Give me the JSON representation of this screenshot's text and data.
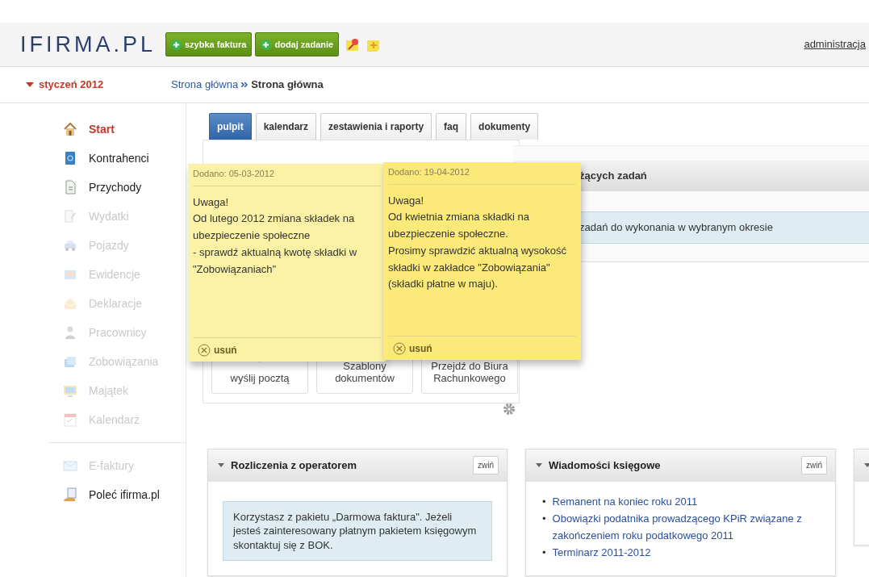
{
  "header": {
    "logo": "IFIRMA.PL",
    "buttons": [
      {
        "label": "szybka faktura"
      },
      {
        "label": "dodaj zadanie"
      }
    ],
    "user_menu": "administracja"
  },
  "period": "styczeń 2012",
  "breadcrumb": [
    "Strona główna",
    "Strona główna"
  ],
  "sidebar": {
    "items": [
      {
        "label": "Start",
        "selected": true,
        "disabled": false
      },
      {
        "label": "Kontrahenci",
        "selected": false,
        "disabled": false
      },
      {
        "label": "Przychody",
        "selected": false,
        "disabled": false
      },
      {
        "label": "Wydatki",
        "selected": false,
        "disabled": true
      },
      {
        "label": "Pojazdy",
        "selected": false,
        "disabled": true
      },
      {
        "label": "Ewidencje",
        "selected": false,
        "disabled": true
      },
      {
        "label": "Deklaracje",
        "selected": false,
        "disabled": true
      },
      {
        "label": "Pracownicy",
        "selected": false,
        "disabled": true
      },
      {
        "label": "Zobowiązania",
        "selected": false,
        "disabled": true
      },
      {
        "label": "Majątek",
        "selected": false,
        "disabled": true
      },
      {
        "label": "Kalendarz",
        "selected": false,
        "disabled": true
      }
    ],
    "extra_items": [
      {
        "label": "E-faktury",
        "selected": false,
        "disabled": true
      },
      {
        "label": "Poleć ifirma.pl",
        "selected": false,
        "disabled": false
      }
    ]
  },
  "tabs": [
    {
      "label": "pulpit",
      "selected": true
    },
    {
      "label": "kalendarz",
      "selected": false
    },
    {
      "label": "zestawienia i raporty",
      "selected": false
    },
    {
      "label": "faq",
      "selected": false
    },
    {
      "label": "dokumenty",
      "selected": false
    }
  ],
  "tiles": [
    {
      "label": "wyślij pocztą"
    },
    {
      "label": "Szablony dokumentów"
    },
    {
      "label": "Przejdź do Biura Rachunkowego"
    }
  ],
  "notes": [
    {
      "date": "Dodano: 05-03-2012",
      "text": "Uwaga!\nOd lutego 2012 zmiana składek na ubezpieczenie społeczne\n- sprawdź aktualną kwotę składki w \"Zobowiązaniach\"",
      "delete": "usuń"
    },
    {
      "date": "Dodano: 19-04-2012",
      "text": "Uwaga!\nOd kwietnia zmiana składki na ubezpieczenie społeczne.\nProsimy sprawdzić aktualną wysokość składki w zakładce \"Zobowiązania\" (składki płatne w maju).",
      "delete": "usuń"
    }
  ],
  "tasks_panel": {
    "title": "żących zadań",
    "message": "zadań do wykonania w wybranym okresie"
  },
  "widgets": [
    {
      "kind": "alert",
      "title": "Rozliczenia z operatorem",
      "collapse": "zwiń",
      "text": "Korzystasz z pakietu „Darmowa faktura\". Jeżeli jesteś zainteresowany płatnym pakietem księgowym skontaktuj się z BOK."
    },
    {
      "kind": "links",
      "title": "Wiadomości księgowe",
      "collapse": "zwiń",
      "links": [
        {
          "bullet": "•",
          "text": "Remanent na koniec roku 2011"
        },
        {
          "bullet": "•",
          "text": "Obowiązki podatnika prowadzącego KPiR związane z zakończeniem roku podatkowego 2011"
        },
        {
          "bullet": "•",
          "text": "Terminarz 2011-2012"
        }
      ]
    },
    {
      "kind": "stub"
    }
  ]
}
